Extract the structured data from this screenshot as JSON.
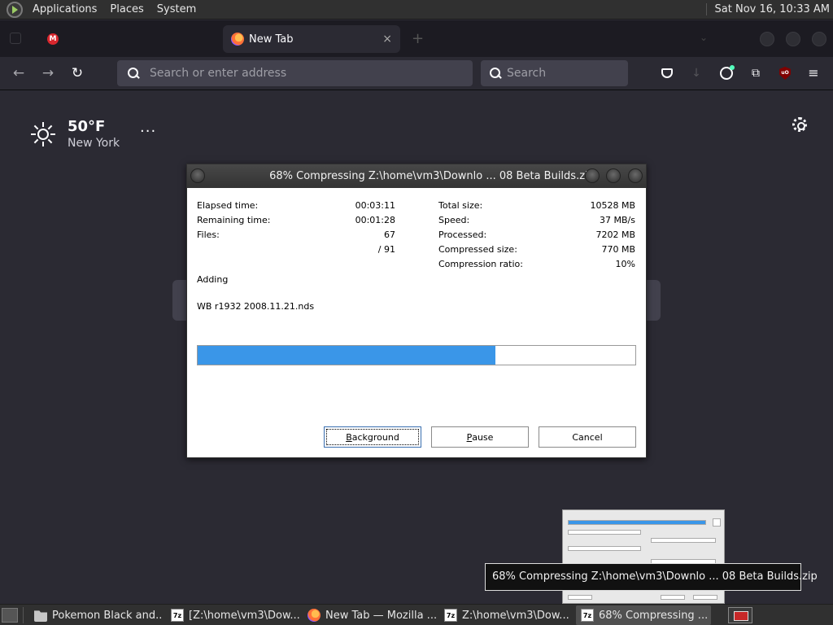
{
  "top_panel": {
    "menus": [
      "Applications",
      "Places",
      "System"
    ],
    "clock": "Sat Nov 16, 10:33 AM"
  },
  "browser": {
    "active_tab": {
      "title": "New Tab"
    },
    "close_glyph": "×",
    "new_tab_glyph": "+",
    "urlbar_placeholder": "Search or enter address",
    "searchbar_placeholder": "Search",
    "nav_glyphs": {
      "back": "←",
      "forward": "→",
      "reload": "↻",
      "menu": "≡",
      "extensions": "⧉",
      "download": "↓",
      "ublock": "uO"
    },
    "weather": {
      "temperature": "50°F",
      "city": "New York",
      "menu_glyph": "···"
    }
  },
  "dialog": {
    "title": "68% Compressing Z:\\home\\vm3\\Downlo ... 08 Beta Builds.zip",
    "left_stats": [
      {
        "label": "Elapsed time:",
        "value": "00:03:11"
      },
      {
        "label": "Remaining time:",
        "value": "00:01:28"
      },
      {
        "label": "Files:",
        "value": "67"
      },
      {
        "label": "",
        "value": "/ 91"
      }
    ],
    "right_stats": [
      {
        "label": "Total size:",
        "value": "10528 MB"
      },
      {
        "label": "Speed:",
        "value": "37 MB/s"
      },
      {
        "label": "Processed:",
        "value": "7202 MB"
      },
      {
        "label": "Compressed size:",
        "value": "770 MB"
      },
      {
        "label": "Compression ratio:",
        "value": "10%"
      }
    ],
    "status": "Adding",
    "current_file": "WB r1932 2008.11.21.nds",
    "progress_fraction": 0.68,
    "buttons": {
      "background": {
        "pre": "",
        "mnemonic": "B",
        "post": "ackground"
      },
      "pause": {
        "pre": "",
        "mnemonic": "P",
        "post": "ause"
      },
      "cancel": {
        "pre": "Cancel",
        "mnemonic": "",
        "post": ""
      }
    }
  },
  "tooltip": "68% Compressing Z:\\home\\vm3\\Downlo ... 08 Beta Builds.zip",
  "taskbar": {
    "tasks": [
      {
        "icon": "folder-icon",
        "label": "Pokemon Black and..."
      },
      {
        "icon": "7zip-icon",
        "label": "[Z:\\home\\vm3\\Dow..."
      },
      {
        "icon": "firefox-icon",
        "label": "New Tab — Mozilla ..."
      },
      {
        "icon": "7zip-icon",
        "label": "Z:\\home\\vm3\\Dow..."
      },
      {
        "icon": "7zip-icon",
        "label": "68% Compressing ..."
      }
    ],
    "zip_icon_text": "7z"
  }
}
